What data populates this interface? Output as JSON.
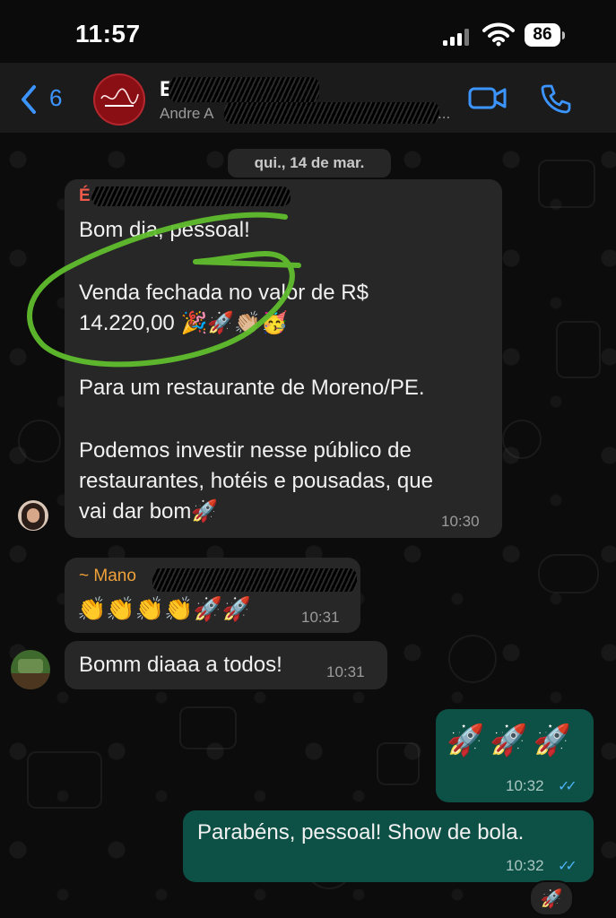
{
  "status_bar": {
    "time": "11:57",
    "battery": "86"
  },
  "header": {
    "back_count": "6",
    "group_name": "E",
    "subtitle": "Andre A",
    "subtitle_more": "..."
  },
  "chat": {
    "date": "qui., 14 de mar.",
    "messages": [
      {
        "sender": "É",
        "lines": [
          "Bom dia, pessoal!",
          "",
          "Venda fechada no valor de R$",
          "14.220,00 🎉🚀👏🏼🥳",
          "",
          "Para um restaurante de Moreno/PE.",
          "",
          "Podemos investir nesse público de",
          "restaurantes, hotéis e pousadas, que",
          "vai dar bom🚀"
        ],
        "time": "10:30"
      },
      {
        "sender": "~ Mano",
        "text": "👏👏👏👏🚀🚀",
        "time": "10:31"
      },
      {
        "text": "Bomm diaaa a todos!",
        "time": "10:31"
      },
      {
        "text": "🚀🚀🚀",
        "time": "10:32",
        "ticks": "✓✓"
      },
      {
        "text": "Parabéns, pessoal! Show de bola.",
        "time": "10:32",
        "ticks": "✓✓"
      }
    ],
    "reaction": "🚀"
  },
  "colors": {
    "accent": "#3c95ff",
    "outgoing_bubble": "#0d5045",
    "incoming_bubble": "#272727",
    "highlight": "#5fbd2c"
  }
}
